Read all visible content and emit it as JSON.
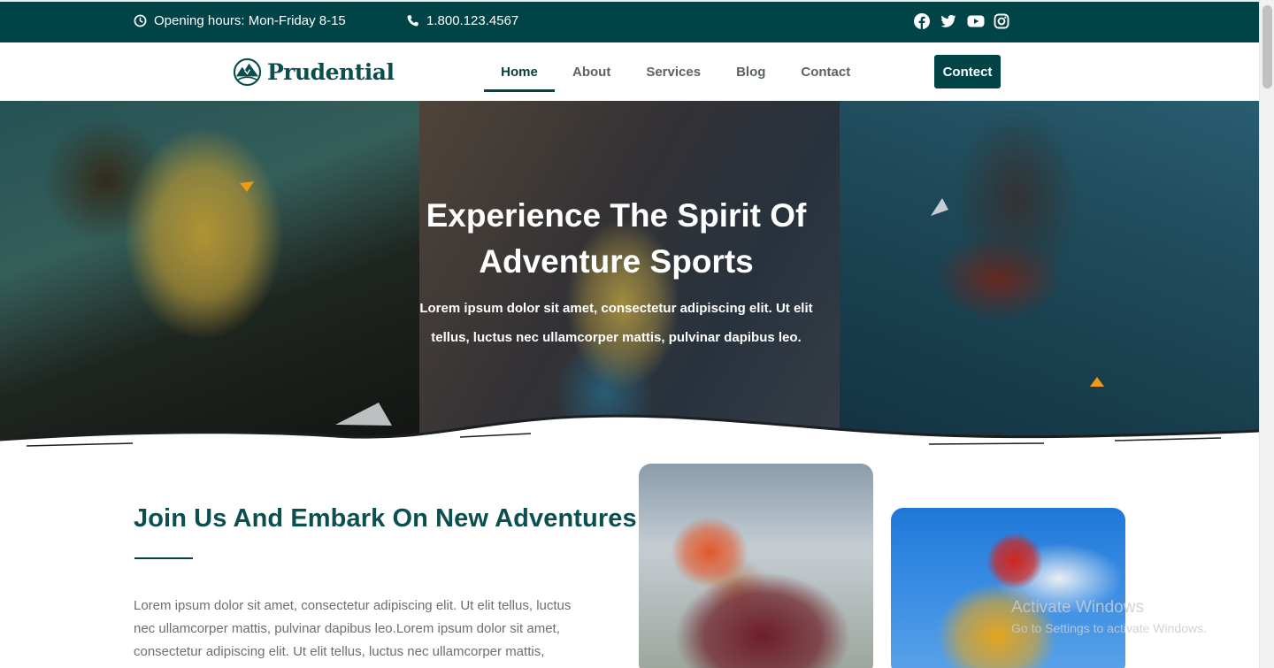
{
  "topbar": {
    "hours": "Opening hours: Mon-Friday 8-15",
    "phone": "1.800.123.4567",
    "hours_icon": "clock-icon",
    "phone_icon": "phone-icon",
    "socials": [
      "facebook-icon",
      "twitter-icon",
      "youtube-icon",
      "instagram-icon"
    ]
  },
  "header": {
    "brand": "Prudential",
    "nav": [
      {
        "label": "Home",
        "active": true
      },
      {
        "label": "About",
        "active": false
      },
      {
        "label": "Services",
        "active": false
      },
      {
        "label": "Blog",
        "active": false
      },
      {
        "label": "Contact",
        "active": false
      }
    ],
    "cta_label": "Contect"
  },
  "hero": {
    "title_line1": "Experience The Spirit Of",
    "title_line2": "Adventure Sports",
    "text_line1": "Lorem ipsum dolor sit amet, consectetur adipiscing elit. Ut elit",
    "text_line2": "tellus, luctus nec ullamcorper mattis, pulvinar dapibus leo."
  },
  "about": {
    "title": "Join Us And Embark On New Adventures",
    "body_line1": "Lorem ipsum dolor sit amet, consectetur adipiscing elit. Ut elit tellus, luctus",
    "body_line2": "nec ullamcorper mattis, pulvinar dapibus leo.Lorem ipsum dolor sit amet,",
    "body_line3": "consectetur adipiscing elit. Ut elit tellus, luctus nec ullamcorper mattis,"
  },
  "watermark": {
    "title": "Activate Windows",
    "subtitle": "Go to Settings to activate Windows."
  },
  "colors": {
    "primary": "#004447",
    "heading": "#0b4f4f",
    "accent_orange": "#f29a12",
    "body_text": "#6b6f73"
  }
}
